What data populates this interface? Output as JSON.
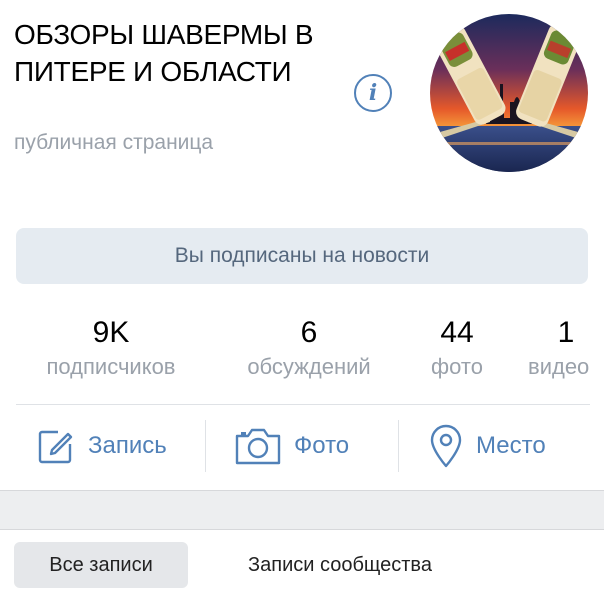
{
  "community": {
    "title": "ОБЗОРЫ ШАВЕРМЫ В ПИТЕРЕ И ОБЛАСТИ",
    "subtitle": "публичная страница"
  },
  "subscribe_button": {
    "label": "Вы подписаны на новости"
  },
  "stats": [
    {
      "value": "9K",
      "label": "подписчиков"
    },
    {
      "value": "6",
      "label": "обсуждений"
    },
    {
      "value": "44",
      "label": "фото"
    },
    {
      "value": "1",
      "label": "видео"
    }
  ],
  "actions": {
    "post": "Запись",
    "photo": "Фото",
    "place": "Место"
  },
  "tabs": {
    "all_posts": "Все записи",
    "community_posts": "Записи сообщества"
  },
  "icons": {
    "info": "info-icon",
    "post": "compose-icon",
    "photo": "camera-icon",
    "place": "location-pin-icon"
  },
  "colors": {
    "accent": "#5181b8",
    "muted_text": "#9aa1aa",
    "button_bg": "#e5ebf1",
    "band_bg": "#edeef0"
  }
}
